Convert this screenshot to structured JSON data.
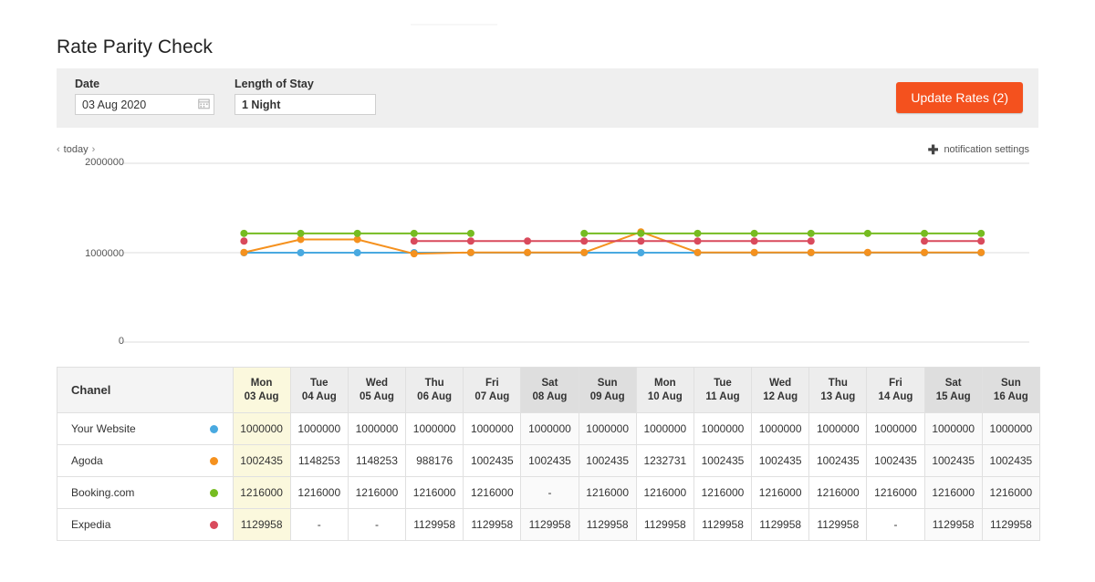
{
  "page_title": "Rate Parity Check",
  "filters": {
    "date": {
      "label": "Date",
      "value": "03 Aug 2020",
      "icon": "calendar-icon"
    },
    "length_of_stay": {
      "label": "Length of Stay",
      "value": "1 Night"
    },
    "update_button": "Update Rates (2)",
    "accent_color": "#f4511e"
  },
  "nav": {
    "prev": "‹",
    "today": "today",
    "next": "›",
    "notification_settings": "notification settings",
    "notification_icon": "plus-icon"
  },
  "table": {
    "channel_header": "Chanel",
    "today_column_index": 0,
    "columns": [
      {
        "dow": "Mon",
        "date": "03 Aug",
        "weekend": false
      },
      {
        "dow": "Tue",
        "date": "04 Aug",
        "weekend": false
      },
      {
        "dow": "Wed",
        "date": "05 Aug",
        "weekend": false
      },
      {
        "dow": "Thu",
        "date": "06 Aug",
        "weekend": false
      },
      {
        "dow": "Fri",
        "date": "07 Aug",
        "weekend": false
      },
      {
        "dow": "Sat",
        "date": "08 Aug",
        "weekend": true
      },
      {
        "dow": "Sun",
        "date": "09 Aug",
        "weekend": true
      },
      {
        "dow": "Mon",
        "date": "10 Aug",
        "weekend": false
      },
      {
        "dow": "Tue",
        "date": "11 Aug",
        "weekend": false
      },
      {
        "dow": "Wed",
        "date": "12 Aug",
        "weekend": false
      },
      {
        "dow": "Thu",
        "date": "13 Aug",
        "weekend": false
      },
      {
        "dow": "Fri",
        "date": "14 Aug",
        "weekend": false
      },
      {
        "dow": "Sat",
        "date": "15 Aug",
        "weekend": true
      },
      {
        "dow": "Sun",
        "date": "16 Aug",
        "weekend": true
      }
    ],
    "rows": [
      {
        "name": "Your Website",
        "color": "#49a9e0",
        "values": [
          "1000000",
          "1000000",
          "1000000",
          "1000000",
          "1000000",
          "1000000",
          "1000000",
          "1000000",
          "1000000",
          "1000000",
          "1000000",
          "1000000",
          "1000000",
          "1000000"
        ]
      },
      {
        "name": "Agoda",
        "color": "#f5911e",
        "values": [
          "1002435",
          "1148253",
          "1148253",
          "988176",
          "1002435",
          "1002435",
          "1002435",
          "1232731",
          "1002435",
          "1002435",
          "1002435",
          "1002435",
          "1002435",
          "1002435"
        ]
      },
      {
        "name": "Booking.com",
        "color": "#76bc21",
        "values": [
          "1216000",
          "1216000",
          "1216000",
          "1216000",
          "1216000",
          "-",
          "1216000",
          "1216000",
          "1216000",
          "1216000",
          "1216000",
          "1216000",
          "1216000",
          "1216000"
        ]
      },
      {
        "name": "Expedia",
        "color": "#d94a5c",
        "values": [
          "1129958",
          "-",
          "-",
          "1129958",
          "1129958",
          "1129958",
          "1129958",
          "1129958",
          "1129958",
          "1129958",
          "1129958",
          "-",
          "1129958",
          "1129958"
        ]
      }
    ]
  },
  "chart_data": {
    "type": "line",
    "title": "",
    "xlabel": "",
    "ylabel": "",
    "ylim": [
      0,
      2000000
    ],
    "yticks": [
      0,
      1000000,
      2000000
    ],
    "ytick_labels": [
      "0",
      "1000000",
      "2000000"
    ],
    "grid": true,
    "legend": "none",
    "categories": [
      "03 Aug",
      "04 Aug",
      "05 Aug",
      "06 Aug",
      "07 Aug",
      "08 Aug",
      "09 Aug",
      "10 Aug",
      "11 Aug",
      "12 Aug",
      "13 Aug",
      "14 Aug",
      "15 Aug",
      "16 Aug"
    ],
    "series": [
      {
        "name": "Your Website",
        "color": "#49a9e0",
        "values": [
          1000000,
          1000000,
          1000000,
          1000000,
          1000000,
          1000000,
          1000000,
          1000000,
          1000000,
          1000000,
          1000000,
          1000000,
          1000000,
          1000000
        ]
      },
      {
        "name": "Agoda",
        "color": "#f5911e",
        "values": [
          1002435,
          1148253,
          1148253,
          988176,
          1002435,
          1002435,
          1002435,
          1232731,
          1002435,
          1002435,
          1002435,
          1002435,
          1002435,
          1002435
        ]
      },
      {
        "name": "Booking.com",
        "color": "#76bc21",
        "values": [
          1216000,
          1216000,
          1216000,
          1216000,
          1216000,
          null,
          1216000,
          1216000,
          1216000,
          1216000,
          1216000,
          1216000,
          1216000,
          1216000
        ]
      },
      {
        "name": "Expedia",
        "color": "#d94a5c",
        "values": [
          1129958,
          null,
          null,
          1129958,
          1129958,
          1129958,
          1129958,
          1129958,
          1129958,
          1129958,
          1129958,
          null,
          1129958,
          1129958
        ]
      }
    ]
  }
}
